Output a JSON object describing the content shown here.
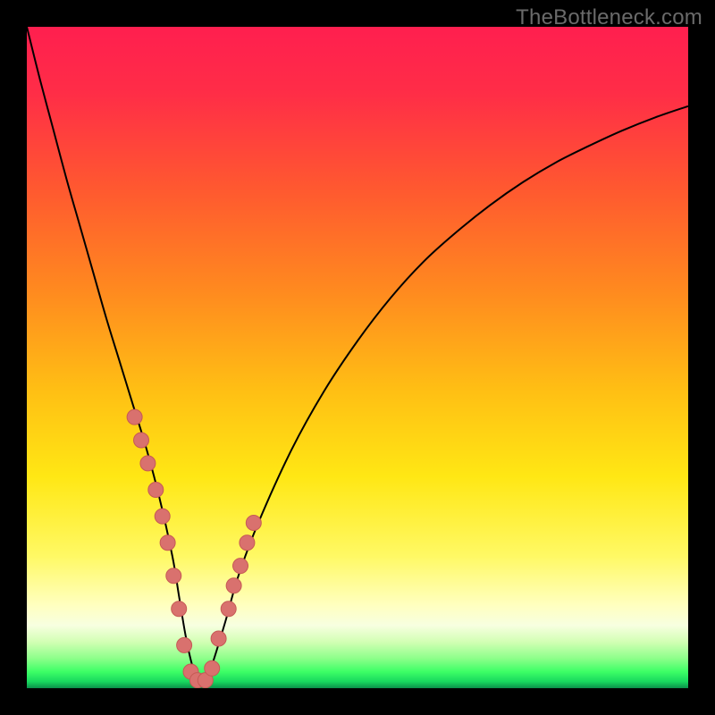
{
  "watermark": "TheBottleneck.com",
  "colors": {
    "frame": "#000000",
    "gradient_stops": [
      {
        "offset": 0.0,
        "color": "#ff1f4f"
      },
      {
        "offset": 0.1,
        "color": "#ff2d47"
      },
      {
        "offset": 0.25,
        "color": "#ff5a2f"
      },
      {
        "offset": 0.4,
        "color": "#ff8a1f"
      },
      {
        "offset": 0.55,
        "color": "#ffbf14"
      },
      {
        "offset": 0.68,
        "color": "#ffe714"
      },
      {
        "offset": 0.8,
        "color": "#fff964"
      },
      {
        "offset": 0.875,
        "color": "#ffffc0"
      },
      {
        "offset": 0.905,
        "color": "#f7ffe0"
      },
      {
        "offset": 0.93,
        "color": "#d2ffb4"
      },
      {
        "offset": 0.955,
        "color": "#8dff8a"
      },
      {
        "offset": 0.975,
        "color": "#3dff66"
      },
      {
        "offset": 0.99,
        "color": "#18d85e"
      },
      {
        "offset": 1.0,
        "color": "#0b8f4a"
      }
    ],
    "curve": "#000000",
    "marker_fill": "#d9716e",
    "marker_stroke": "#c65a55"
  },
  "chart_data": {
    "type": "line",
    "title": "",
    "xlabel": "",
    "ylabel": "",
    "xlim": [
      0,
      100
    ],
    "ylim": [
      0,
      100
    ],
    "series": [
      {
        "name": "bottleneck-curve",
        "x": [
          0,
          2,
          4,
          6,
          8,
          10,
          12,
          14,
          16,
          18,
          20,
          22,
          23,
          24,
          25,
          26,
          27,
          28,
          30,
          32,
          35,
          40,
          45,
          50,
          55,
          60,
          65,
          70,
          75,
          80,
          85,
          90,
          95,
          100
        ],
        "y": [
          100,
          92,
          84.5,
          77,
          70,
          63,
          56,
          49.5,
          43,
          36.5,
          29,
          20,
          14,
          8,
          3.5,
          1,
          1,
          3.5,
          10,
          17,
          25,
          36,
          45,
          52.5,
          59,
          64.5,
          69,
          73,
          76.5,
          79.5,
          82,
          84.3,
          86.3,
          88
        ]
      }
    ],
    "markers": {
      "name": "highlight-points",
      "x": [
        16.3,
        17.3,
        18.3,
        19.5,
        20.5,
        21.3,
        22.2,
        23.0,
        23.8,
        24.8,
        25.8,
        27.0,
        28.0,
        29.0,
        30.5,
        31.3,
        32.3,
        33.3,
        34.3
      ],
      "y": [
        41.0,
        37.5,
        34.0,
        30.0,
        26.0,
        22.0,
        17.0,
        12.0,
        6.5,
        2.5,
        1.2,
        1.2,
        3.0,
        7.5,
        12.0,
        15.5,
        18.5,
        22.0,
        25.0
      ]
    }
  }
}
